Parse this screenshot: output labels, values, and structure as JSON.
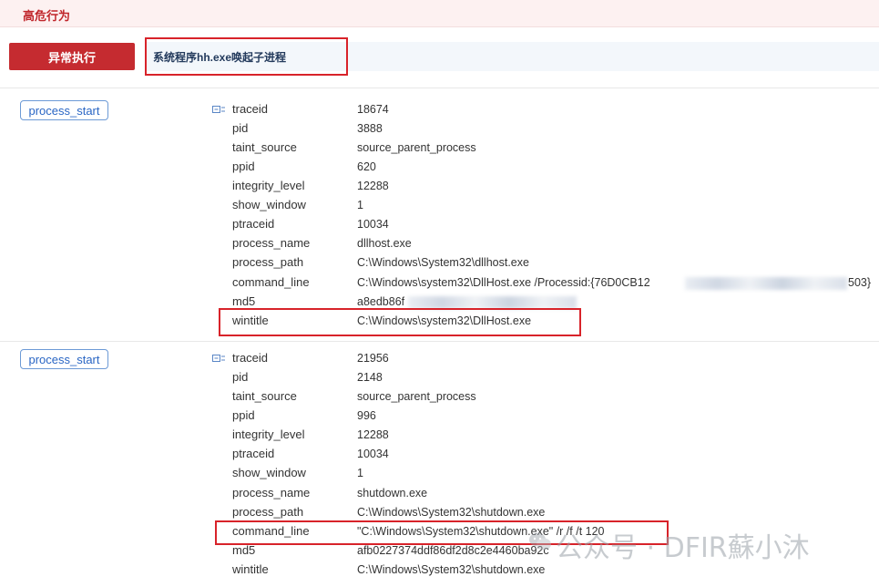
{
  "header": {
    "title": "高危行为"
  },
  "behavior": {
    "category": "异常执行",
    "description": "系统程序hh.exe唤起子进程"
  },
  "events": [
    {
      "tag": "process_start",
      "fields": [
        {
          "key": "traceid",
          "value": "18674"
        },
        {
          "key": "pid",
          "value": "3888"
        },
        {
          "key": "taint_source",
          "value": "source_parent_process"
        },
        {
          "key": "ppid",
          "value": "620"
        },
        {
          "key": "integrity_level",
          "value": "12288"
        },
        {
          "key": "show_window",
          "value": "1"
        },
        {
          "key": "ptraceid",
          "value": "10034"
        },
        {
          "key": "process_name",
          "value": "dllhost.exe"
        },
        {
          "key": "process_path",
          "value": "C:\\Windows\\System32\\dllhost.exe"
        },
        {
          "key": "command_line",
          "value": "C:\\Windows\\system32\\DllHost.exe /Processid:{76D0CB12"
        },
        {
          "key": "md5",
          "value": "a8edb86f"
        },
        {
          "key": "wintitle",
          "value": "C:\\Windows\\system32\\DllHost.exe"
        }
      ],
      "command_line_tail": "503}"
    },
    {
      "tag": "process_start",
      "fields": [
        {
          "key": "traceid",
          "value": "21956"
        },
        {
          "key": "pid",
          "value": "2148"
        },
        {
          "key": "taint_source",
          "value": "source_parent_process"
        },
        {
          "key": "ppid",
          "value": "996"
        },
        {
          "key": "integrity_level",
          "value": "12288"
        },
        {
          "key": "ptraceid",
          "value": "10034"
        },
        {
          "key": "show_window",
          "value": "1"
        },
        {
          "key": "process_name",
          "value": "shutdown.exe"
        },
        {
          "key": "process_path",
          "value": "C:\\Windows\\System32\\shutdown.exe"
        },
        {
          "key": "command_line",
          "value": "\"C:\\Windows\\System32\\shutdown.exe\" /r /f /t 120"
        },
        {
          "key": "md5",
          "value": "afb0227374ddf86df2d8c2e4460ba92c"
        },
        {
          "key": "wintitle",
          "value": "C:\\Windows\\System32\\shutdown.exe"
        }
      ]
    }
  ],
  "watermark": {
    "text": "公众号 · DFIR蘇小沐"
  },
  "icons": {
    "expand": "expand-collapse-icon",
    "wechat": "wechat-logo-icon"
  },
  "colors": {
    "danger": "#c52b30",
    "link": "#2a66c4",
    "highlight_box": "#d8232a"
  }
}
